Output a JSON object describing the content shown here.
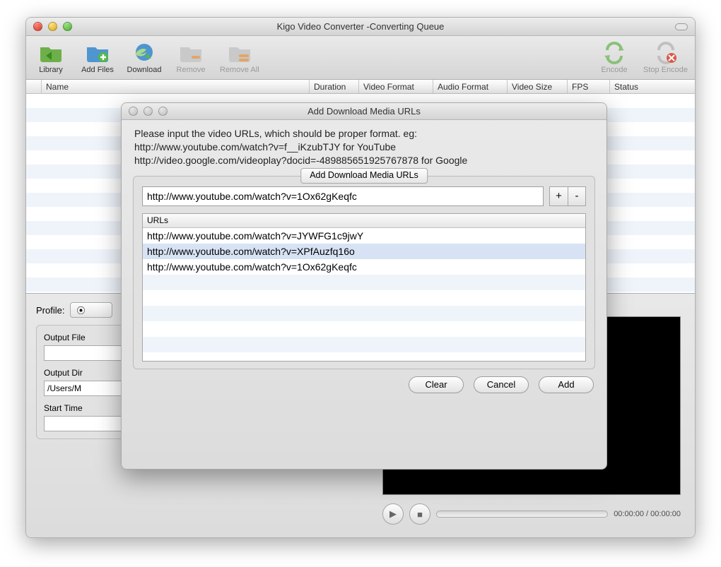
{
  "window": {
    "title": "Kigo Video Converter -Converting Queue"
  },
  "toolbar": {
    "library": "Library",
    "add_files": "Add Files",
    "download": "Download",
    "remove": "Remove",
    "remove_all": "Remove All",
    "encode": "Encode",
    "stop_encode": "Stop Encode"
  },
  "columns": {
    "name": "Name",
    "duration": "Duration",
    "video_format": "Video Format",
    "audio_format": "Audio Format",
    "video_size": "Video Size",
    "fps": "FPS",
    "status": "Status"
  },
  "profile_label": "Profile:",
  "output_file_label": "Output File",
  "output_dir_label": "Output Dir",
  "output_dir_value": "/Users/M",
  "start_time_label": "Start Time",
  "timecode": "00:00:00 / 00:00:00",
  "dialog": {
    "title": "Add Download Media URLs",
    "instructions_line1": "Please input the video URLs, which should be proper format. eg:",
    "instructions_line2": "http://www.youtube.com/watch?v=f__iKzubTJY  for YouTube",
    "instructions_line3": "http://video.google.com/videoplay?docid=-489885651925767878 for Google",
    "legend": "Add Download Media URLs",
    "url_input": "http://www.youtube.com/watch?v=1Ox62gKeqfc",
    "plus": "+",
    "minus": "-",
    "urls_header": "URLs",
    "urls": [
      "http://www.youtube.com/watch?v=JYWFG1c9jwY",
      "http://www.youtube.com/watch?v=XPfAuzfq16o",
      "http://www.youtube.com/watch?v=1Ox62gKeqfc"
    ],
    "clear": "Clear",
    "cancel": "Cancel",
    "add": "Add"
  }
}
